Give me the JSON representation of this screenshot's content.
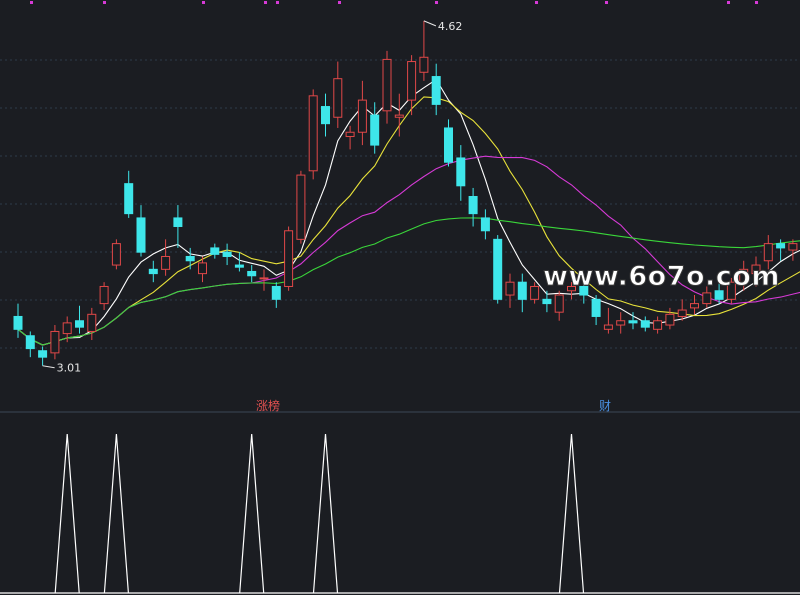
{
  "chart_data": [
    {
      "type": "candlestick",
      "panel": "price",
      "colors": {
        "up": "#e04848",
        "down": "#3ee6ea",
        "background": "#1b1d22",
        "grid": "#2e3a4a"
      },
      "annotations": {
        "high_label": "4.62",
        "low_label": "3.01",
        "event_tag_1": "涨榜",
        "event_tag_2": "财"
      },
      "watermark": "www.6o7o.com",
      "ylim": [
        2.85,
        4.68
      ],
      "candles": [
        [
          3.24,
          3.3,
          3.14,
          3.18
        ],
        [
          3.15,
          3.17,
          3.05,
          3.09
        ],
        [
          3.08,
          3.1,
          3.01,
          3.05
        ],
        [
          3.07,
          3.2,
          3.04,
          3.17
        ],
        [
          3.16,
          3.24,
          3.12,
          3.21
        ],
        [
          3.22,
          3.29,
          3.16,
          3.19
        ],
        [
          3.17,
          3.28,
          3.13,
          3.25
        ],
        [
          3.3,
          3.4,
          3.27,
          3.38
        ],
        [
          3.48,
          3.6,
          3.46,
          3.58
        ],
        [
          3.86,
          3.92,
          3.7,
          3.72
        ],
        [
          3.7,
          3.76,
          3.52,
          3.54
        ],
        [
          3.46,
          3.5,
          3.4,
          3.44
        ],
        [
          3.46,
          3.6,
          3.43,
          3.52
        ],
        [
          3.7,
          3.76,
          3.56,
          3.66
        ],
        [
          3.52,
          3.56,
          3.46,
          3.5
        ],
        [
          3.44,
          3.52,
          3.4,
          3.49
        ],
        [
          3.56,
          3.58,
          3.51,
          3.53
        ],
        [
          3.54,
          3.58,
          3.48,
          3.52
        ],
        [
          3.48,
          3.54,
          3.45,
          3.47
        ],
        [
          3.45,
          3.48,
          3.4,
          3.43
        ],
        [
          3.42,
          3.46,
          3.36,
          3.42
        ],
        [
          3.38,
          3.4,
          3.28,
          3.32
        ],
        [
          3.38,
          3.66,
          3.36,
          3.64
        ],
        [
          3.6,
          3.92,
          3.58,
          3.9
        ],
        [
          3.92,
          4.3,
          3.88,
          4.27
        ],
        [
          4.22,
          4.28,
          4.08,
          4.14
        ],
        [
          4.17,
          4.43,
          4.12,
          4.35
        ],
        [
          4.08,
          4.13,
          4.02,
          4.1
        ],
        [
          4.1,
          4.34,
          4.04,
          4.25
        ],
        [
          4.18,
          4.24,
          4.0,
          4.04
        ],
        [
          4.2,
          4.48,
          4.14,
          4.44
        ],
        [
          4.17,
          4.28,
          4.08,
          4.18
        ],
        [
          4.25,
          4.46,
          4.18,
          4.43
        ],
        [
          4.38,
          4.62,
          4.34,
          4.45
        ],
        [
          4.36,
          4.42,
          4.18,
          4.23
        ],
        [
          4.12,
          4.16,
          3.94,
          3.96
        ],
        [
          3.98,
          4.04,
          3.78,
          3.85
        ],
        [
          3.8,
          3.84,
          3.66,
          3.72
        ],
        [
          3.7,
          3.74,
          3.6,
          3.64
        ],
        [
          3.6,
          3.62,
          3.3,
          3.32
        ],
        [
          3.34,
          3.44,
          3.28,
          3.4
        ],
        [
          3.4,
          3.44,
          3.26,
          3.32
        ],
        [
          3.32,
          3.4,
          3.3,
          3.38
        ],
        [
          3.32,
          3.36,
          3.26,
          3.3
        ],
        [
          3.26,
          3.36,
          3.22,
          3.34
        ],
        [
          3.36,
          3.4,
          3.32,
          3.38
        ],
        [
          3.38,
          3.42,
          3.3,
          3.34
        ],
        [
          3.32,
          3.34,
          3.2,
          3.24
        ],
        [
          3.18,
          3.28,
          3.16,
          3.2
        ],
        [
          3.2,
          3.26,
          3.16,
          3.22
        ],
        [
          3.22,
          3.26,
          3.18,
          3.21
        ],
        [
          3.22,
          3.24,
          3.17,
          3.19
        ],
        [
          3.18,
          3.24,
          3.16,
          3.22
        ],
        [
          3.2,
          3.28,
          3.18,
          3.25
        ],
        [
          3.24,
          3.32,
          3.22,
          3.27
        ],
        [
          3.28,
          3.34,
          3.25,
          3.3
        ],
        [
          3.3,
          3.38,
          3.28,
          3.35
        ],
        [
          3.36,
          3.4,
          3.3,
          3.32
        ],
        [
          3.32,
          3.42,
          3.3,
          3.4
        ],
        [
          3.4,
          3.5,
          3.36,
          3.46
        ],
        [
          3.44,
          3.52,
          3.38,
          3.48
        ],
        [
          3.5,
          3.62,
          3.46,
          3.58
        ],
        [
          3.58,
          3.6,
          3.5,
          3.56
        ],
        [
          3.55,
          3.6,
          3.5,
          3.58
        ],
        [
          3.62,
          3.64,
          3.54,
          3.6
        ],
        [
          3.56,
          3.64,
          3.52,
          3.62
        ],
        [
          3.58,
          3.66,
          3.56,
          3.64
        ],
        [
          3.64,
          3.7,
          3.58,
          3.66
        ],
        [
          3.7,
          3.76,
          3.62,
          3.72
        ],
        [
          3.66,
          3.7,
          3.6,
          3.68
        ],
        [
          3.7,
          3.78,
          3.66,
          3.76
        ],
        [
          3.76,
          3.8,
          3.7,
          3.74
        ],
        [
          3.74,
          3.8,
          3.68,
          3.72
        ],
        [
          3.74,
          3.82,
          3.7,
          3.78
        ],
        [
          3.78,
          3.84,
          3.7,
          3.74
        ],
        [
          3.7,
          3.74,
          3.54,
          3.56
        ],
        [
          3.56,
          3.66,
          3.52,
          3.62
        ],
        [
          3.62,
          3.68,
          3.56,
          3.6
        ],
        [
          3.56,
          3.62,
          3.44,
          3.48
        ],
        [
          3.46,
          3.5,
          3.36,
          3.38
        ]
      ],
      "moving_averages": [
        {
          "period": 5,
          "color": "#ffffff"
        },
        {
          "period": 10,
          "color": "#e8e23a"
        },
        {
          "period": 20,
          "color": "#d63ad6"
        },
        {
          "period": 60,
          "color": "#3ad63a"
        }
      ]
    },
    {
      "type": "spike",
      "panel": "indicator",
      "colors": {
        "line": "#ffffff"
      },
      "signals": [
        4,
        8,
        19,
        25,
        45
      ]
    }
  ]
}
